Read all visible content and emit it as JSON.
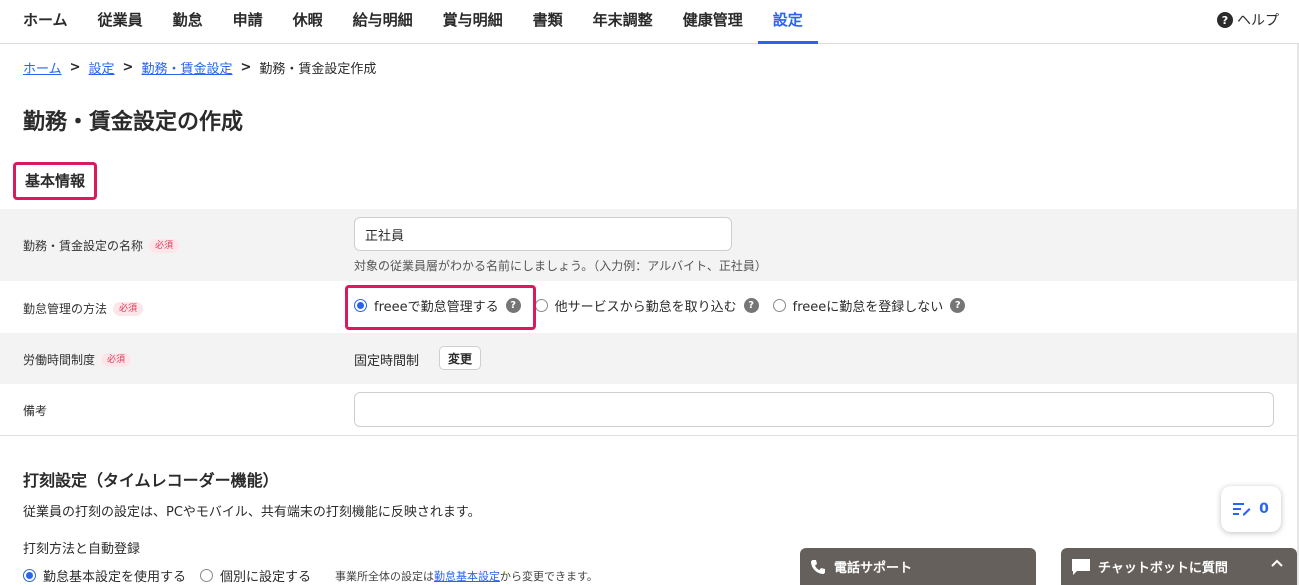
{
  "nav": {
    "tabs": [
      {
        "label": "ホーム"
      },
      {
        "label": "従業員"
      },
      {
        "label": "勤怠"
      },
      {
        "label": "申請"
      },
      {
        "label": "休暇"
      },
      {
        "label": "給与明細"
      },
      {
        "label": "賞与明細"
      },
      {
        "label": "書類"
      },
      {
        "label": "年末調整"
      },
      {
        "label": "健康管理"
      },
      {
        "label": "設定"
      }
    ],
    "active_tab": "設定",
    "help_label": "ヘルプ"
  },
  "breadcrumb": {
    "items": [
      "ホーム",
      "設定",
      "勤務・賃金設定"
    ],
    "current": "勤務・賃金設定作成"
  },
  "page_title": "勤務・賃金設定の作成",
  "section_basic": {
    "title": "基本情報",
    "name_row": {
      "label": "勤務・賃金設定の名称",
      "required": "必須",
      "value": "正社員",
      "hint": "対象の従業員層がわかる名前にしましょう。（入力例：アルバイト、正社員）"
    },
    "attendance_row": {
      "label": "勤怠管理の方法",
      "required": "必須",
      "options": [
        "freeeで勤怠管理する",
        "他サービスから勤怠を取り込む",
        "freeeに勤怠を登録しない"
      ],
      "selected": "freeeで勤怠管理する"
    },
    "work_hours_row": {
      "label": "労働時間制度",
      "required": "必須",
      "value": "固定時間制",
      "change_button": "変更"
    },
    "notes_row": {
      "label": "備考",
      "value": ""
    }
  },
  "section_clock": {
    "title": "打刻設定（タイムレコーダー機能）",
    "description": "従業員の打刻の設定は、PCやモバイル、共有端末の打刻機能に反映されます。",
    "subheading": "打刻方法と自動登録",
    "options": [
      "勤怠基本設定を使用する",
      "個別に設定する"
    ],
    "selected": "勤怠基本設定を使用する",
    "note_prefix": "事業所全体の設定は",
    "note_link": "勤怠基本設定",
    "note_suffix": "から変更できます。"
  },
  "widgets": {
    "todo_count": "0",
    "phone_support": "電話サポート",
    "chatbot": "チャットボットに質問"
  },
  "colors": {
    "accent": "#2864f0",
    "highlight": "#d91a5f",
    "required_text": "#d93b57",
    "widget_bg": "#66605c"
  }
}
